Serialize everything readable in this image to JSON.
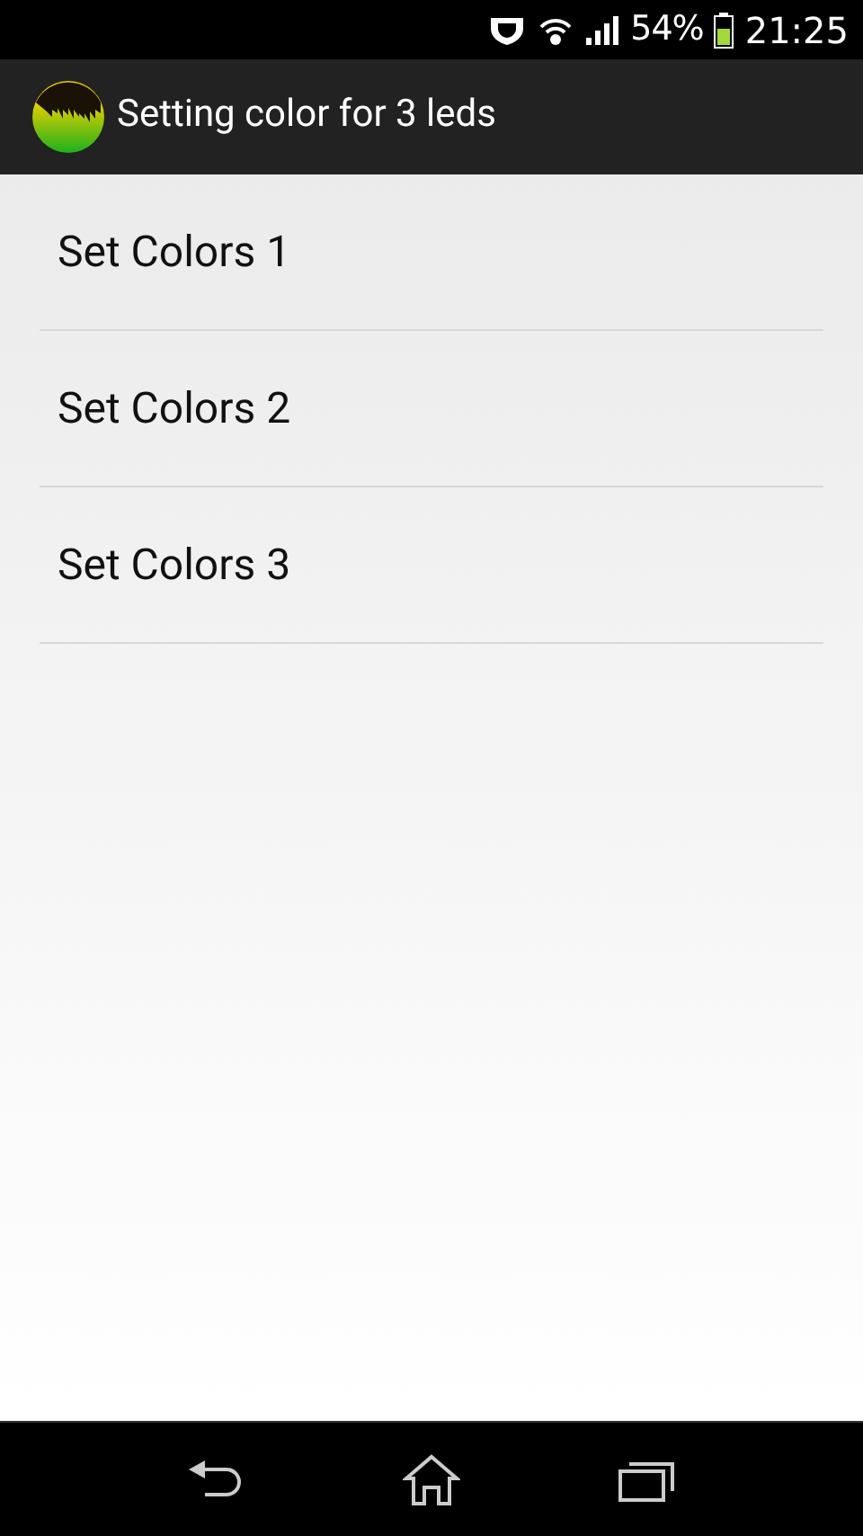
{
  "status_bar": {
    "battery": "54%",
    "time": "21:25"
  },
  "action_bar": {
    "title": "Setting color for 3 leds"
  },
  "list": {
    "items": [
      {
        "label": "Set Colors 1"
      },
      {
        "label": "Set Colors 2"
      },
      {
        "label": "Set Colors 3"
      }
    ]
  }
}
